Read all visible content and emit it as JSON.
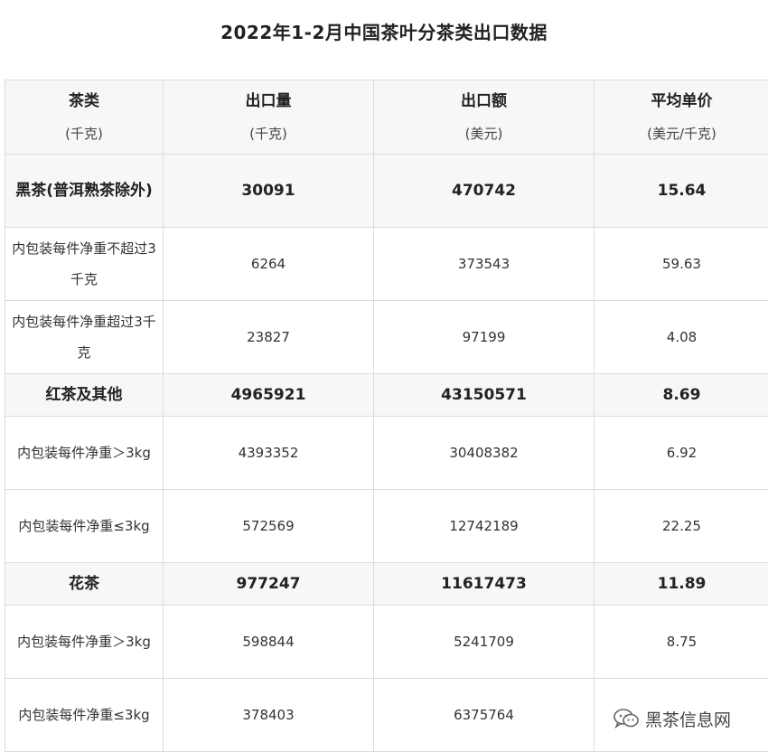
{
  "title": "2022年1-2月中国茶叶分茶类出口数据",
  "headers": [
    {
      "label": "茶类",
      "unit": "(千克)"
    },
    {
      "label": "出口量",
      "unit": "(千克)"
    },
    {
      "label": "出口额",
      "unit": "(美元)"
    },
    {
      "label": "平均单价",
      "unit": "(美元/千克)"
    }
  ],
  "rows": [
    {
      "name": "黑茶(普洱熟茶除外)",
      "volume": "30091",
      "value": "470742",
      "price": "15.64"
    },
    {
      "name": "内包装每件净重不超过3千克",
      "volume": "6264",
      "value": "373543",
      "price": "59.63"
    },
    {
      "name": "内包装每件净重超过3千克",
      "volume": "23827",
      "value": "97199",
      "price": "4.08"
    },
    {
      "name": "红茶及其他",
      "volume": "4965921",
      "value": "43150571",
      "price": "8.69"
    },
    {
      "name": "内包装每件净重＞3kg",
      "volume": "4393352",
      "value": "30408382",
      "price": "6.92"
    },
    {
      "name": "内包装每件净重≤3kg",
      "volume": "572569",
      "value": "12742189",
      "price": "22.25"
    },
    {
      "name": "花茶",
      "volume": "977247",
      "value": "11617473",
      "price": "11.89"
    },
    {
      "name": "内包装每件净重＞3kg",
      "volume": "598844",
      "value": "5241709",
      "price": "8.75"
    },
    {
      "name": "内包装每件净重≤3kg",
      "volume": "378403",
      "value": "6375764",
      "price": ""
    }
  ],
  "watermark": {
    "text": "黑茶信息网",
    "icon": "wechat-icon"
  }
}
